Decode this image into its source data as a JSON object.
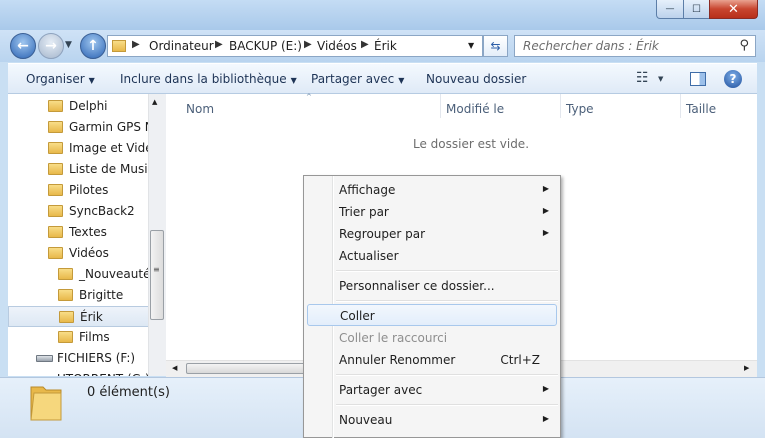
{
  "window": {
    "minimize_glyph": "—",
    "maximize_glyph": "☐",
    "close_glyph": "✕"
  },
  "address": {
    "crumbs": [
      "Ordinateur",
      "BACKUP (E:)",
      "Vidéos",
      "Érik"
    ]
  },
  "search": {
    "placeholder": "Rechercher dans : Érik"
  },
  "toolbar": {
    "organize": "Organiser",
    "include": "Inclure dans la bibliothèque",
    "share": "Partager avec",
    "new_folder": "Nouveau dossier"
  },
  "tree": [
    {
      "label": "Delphi",
      "level": 0
    },
    {
      "label": "Garmin GPS NU",
      "level": 0
    },
    {
      "label": "Image et Vidéo",
      "level": 0
    },
    {
      "label": "Liste de Musiqu",
      "level": 0
    },
    {
      "label": "Pilotes",
      "level": 0
    },
    {
      "label": "SyncBack2",
      "level": 0
    },
    {
      "label": "Textes",
      "level": 0
    },
    {
      "label": "Vidéos",
      "level": 0
    },
    {
      "label": "_Nouveautés",
      "level": 1
    },
    {
      "label": "Brigitte",
      "level": 1
    },
    {
      "label": "Érik",
      "level": 1,
      "selected": true
    },
    {
      "label": "Films",
      "level": 1
    },
    {
      "label": "FICHIERS (F:)",
      "level": -1,
      "drive": true
    },
    {
      "label": "UTORRENT (G:)",
      "level": -1,
      "drive": true
    }
  ],
  "columns": {
    "name": "Nom",
    "modified": "Modifié le",
    "type": "Type",
    "size": "Taille"
  },
  "content": {
    "empty": "Le dossier est vide."
  },
  "details": {
    "count": "0 élément(s)"
  },
  "context_menu": {
    "view": "Affichage",
    "sort": "Trier par",
    "group": "Regrouper par",
    "refresh": "Actualiser",
    "customize": "Personnaliser ce dossier...",
    "paste": "Coller",
    "paste_shortcut": "Coller le raccourci",
    "undo": "Annuler Renommer",
    "undo_key": "Ctrl+Z",
    "share": "Partager avec",
    "new": "Nouveau"
  }
}
